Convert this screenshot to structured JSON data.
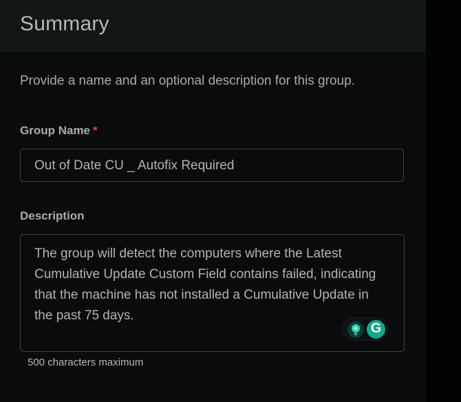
{
  "header": {
    "title": "Summary"
  },
  "intro": {
    "text": "Provide a name and an optional description for this group."
  },
  "fields": {
    "group_name": {
      "label": "Group Name",
      "required_mark": "*",
      "value": "Out of Date CU _ Autofix Required"
    },
    "description": {
      "label": "Description",
      "value": "The group will detect the computers where the Latest Cumulative Update Custom Field contains failed, indicating that the machine has not installed a Cumulative Update in the past 75 days.",
      "helper": "500 characters maximum"
    }
  },
  "writing_assistant": {
    "icons": [
      "sparkle-bulb-icon",
      "grammarly-g-icon"
    ],
    "g_letter": "G",
    "colors": {
      "accent": "#14a88b",
      "bulb_bg": "#0c3b35"
    }
  },
  "colors": {
    "background": "#0a0b0c",
    "header": "#121615",
    "text": "#b1b5af",
    "border": "#3f4340",
    "required": "#d5483f"
  }
}
